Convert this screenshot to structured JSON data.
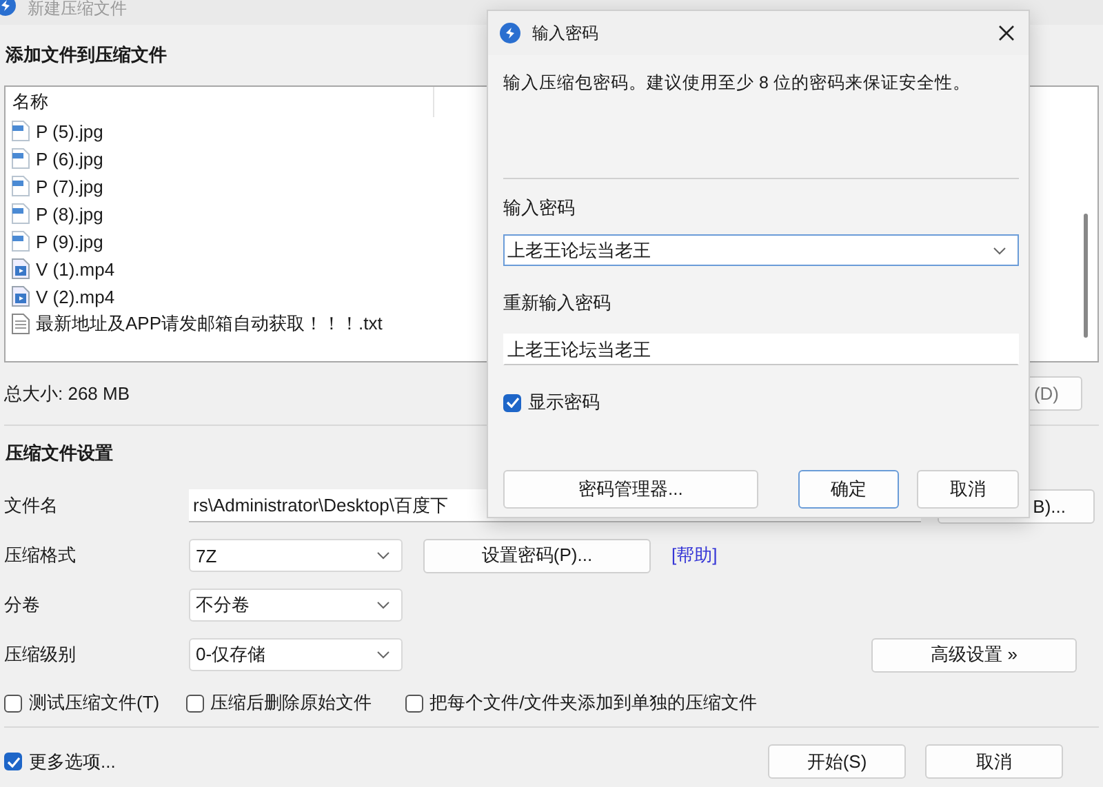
{
  "main_window": {
    "title": "新建压缩文件",
    "files_section": {
      "heading": "添加文件到压缩文件",
      "column": "名称",
      "files": [
        {
          "name": "P (5).jpg",
          "kind": "image"
        },
        {
          "name": "P (6).jpg",
          "kind": "image"
        },
        {
          "name": "P (7).jpg",
          "kind": "image"
        },
        {
          "name": "P (8).jpg",
          "kind": "image"
        },
        {
          "name": "P (9).jpg",
          "kind": "image"
        },
        {
          "name": "V (1).mp4",
          "kind": "video"
        },
        {
          "name": "V (2).mp4",
          "kind": "video"
        },
        {
          "name": "最新地址及APP请发邮箱自动获取！！！.txt",
          "kind": "text"
        }
      ]
    },
    "total_size": "总大小: 268 MB",
    "total_button": "(D)",
    "settings": {
      "heading": "压缩文件设置",
      "filename": {
        "label": "文件名",
        "value": "rs\\Administrator\\Desktop\\百度下",
        "button": "B)..."
      },
      "format": {
        "label": "压缩格式",
        "value": "7Z",
        "button": "设置密码(P)...",
        "link": "[帮助]"
      },
      "volume": {
        "label": "分卷",
        "value": "不分卷"
      },
      "level": {
        "label": "压缩级别",
        "value": "0-仅存储",
        "button": "高级设置 »"
      },
      "options": [
        {
          "label": "测试压缩文件(T)",
          "checked": false
        },
        {
          "label": "压缩后删除原始文件",
          "checked": false
        },
        {
          "label": "把每个文件/文件夹添加到单独的压缩文件",
          "checked": false
        }
      ]
    },
    "more_options": {
      "label": "更多选项...",
      "checked": true
    },
    "buttons": [
      "开始(S)",
      "取消"
    ]
  },
  "dialog": {
    "title": "输入密码",
    "message": "输入压缩包密码。建议使用至少 8 位的密码来保证安全性。",
    "password_label": "输入密码",
    "password": {
      "value": "上老王论坛当老王",
      "focused": true
    },
    "confirm_label": "重新输入密码",
    "confirm": {
      "value": "上老王论坛当老王",
      "focused": false
    },
    "show_password": {
      "label": "显示密码",
      "checked": true
    },
    "buttons": [
      {
        "label": "密码管理器...",
        "default": false
      },
      {
        "label": "确定",
        "default": true
      },
      {
        "label": "取消",
        "default": false
      }
    ]
  }
}
